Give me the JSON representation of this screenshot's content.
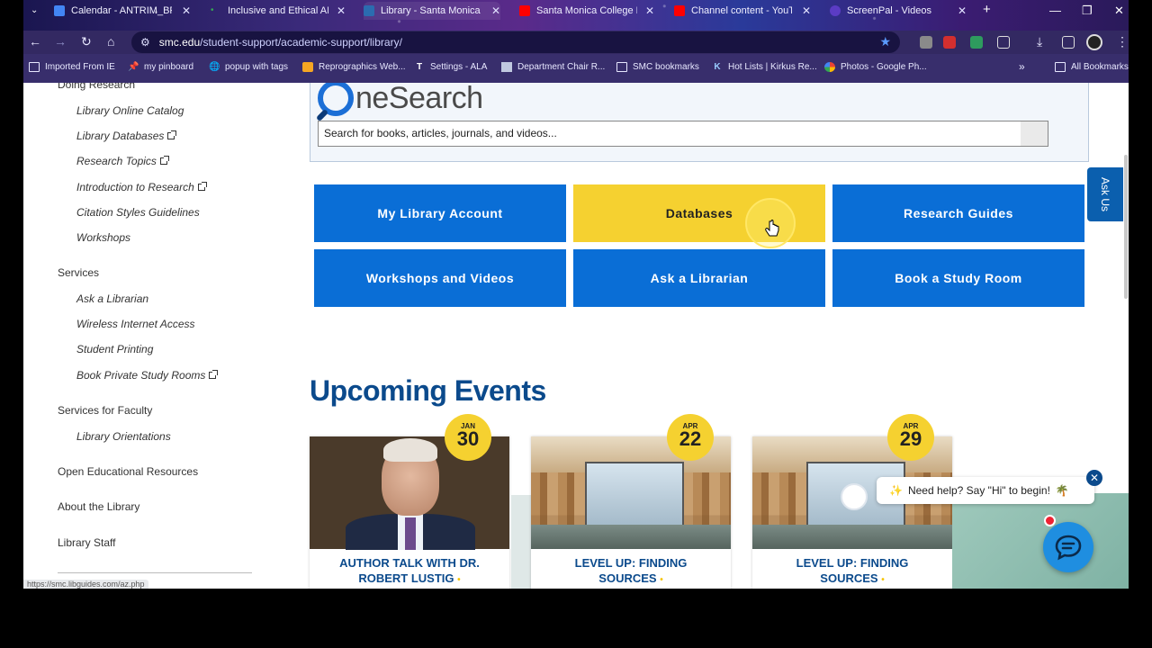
{
  "browser": {
    "tabs": [
      {
        "label": "Calendar - ANTRIM_BREN",
        "fav": "#4285f4"
      },
      {
        "label": "Inclusive and Ethical AI for",
        "fav": "#34a853"
      },
      {
        "label": "Library - Santa Monica Col",
        "fav": "#2b6cb0"
      },
      {
        "label": "Santa Monica College Libr",
        "fav": "#ff0000"
      },
      {
        "label": "Channel content - YouTub",
        "fav": "#ff0000"
      },
      {
        "label": "ScreenPal - Videos",
        "fav": "#5b3cc4"
      }
    ],
    "url_host": "smc.edu",
    "url_path": "/student-support/academic-support/library/",
    "bookmarks": [
      "Imported From IE",
      "my pinboard",
      "popup with tags",
      "Reprographics Web...",
      "Settings - ALA",
      "Department Chair R...",
      "SMC bookmarks",
      "Hot Lists | Kirkus Re...",
      "Photos - Google Ph..."
    ],
    "all_bookmarks": "All Bookmarks",
    "status_url": "https://smc.libguides.com/az.php"
  },
  "sidebar": {
    "doing_research": "Doing Research",
    "research_items": [
      "Library Online Catalog",
      "Library Databases",
      "Research Topics",
      "Introduction to Research",
      "Citation Styles Guidelines",
      "Workshops"
    ],
    "services": "Services",
    "service_items": [
      "Ask a Librarian",
      "Wireless Internet Access",
      "Student Printing",
      "Book Private Study Rooms"
    ],
    "faculty": "Services for Faculty",
    "faculty_items": [
      "Library Orientations"
    ],
    "oer": "Open Educational Resources",
    "about": "About the Library",
    "staff": "Library Staff"
  },
  "onesearch": {
    "logo_word": "neSearch",
    "placeholder": "Search for books, articles, journals, and videos..."
  },
  "tiles": [
    "My Library Account",
    "Databases",
    "Research Guides",
    "Workshops and Videos",
    "Ask a Librarian",
    "Book a Study Room"
  ],
  "ask_us": "Ask Us",
  "events": {
    "heading": "Upcoming Events",
    "cards": [
      {
        "month": "JAN",
        "day": "30",
        "line1": "AUTHOR TALK WITH DR.",
        "line2": "ROBERT LUSTIG"
      },
      {
        "month": "APR",
        "day": "22",
        "line1": "LEVEL UP: FINDING",
        "line2": "SOURCES"
      },
      {
        "month": "APR",
        "day": "29",
        "line1": "LEVEL UP: FINDING",
        "line2": "SOURCES"
      }
    ]
  },
  "chat": {
    "prompt": "Need help? Say \"Hi\" to begin!",
    "close": "✕"
  }
}
